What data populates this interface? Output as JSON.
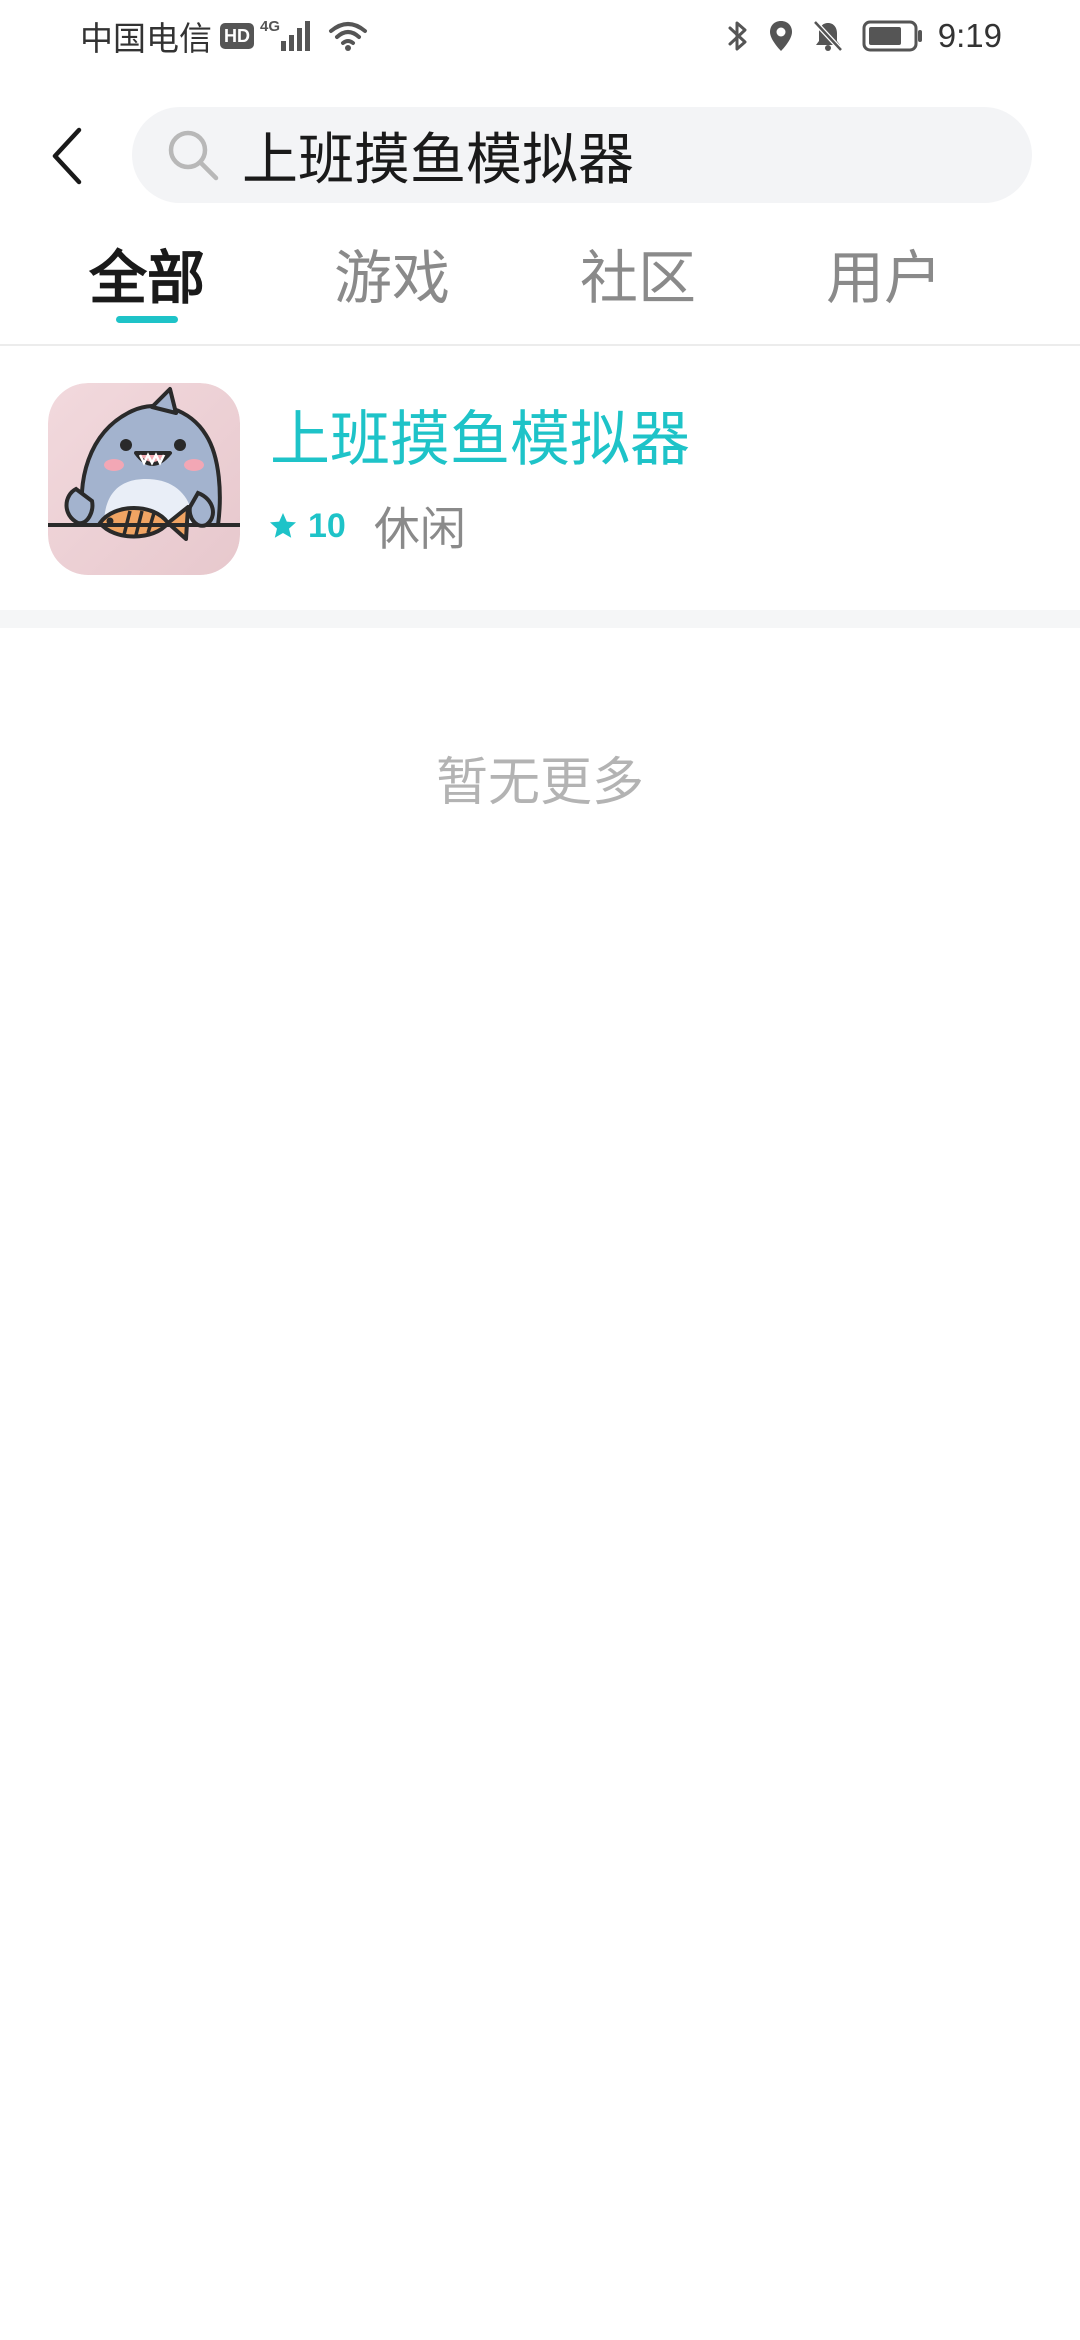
{
  "status_bar": {
    "carrier": "中国电信",
    "hd_badge": "HD",
    "network_type": "4G",
    "time": "9:19",
    "icons": [
      "signal-icon",
      "wifi-icon",
      "bluetooth-icon",
      "location-icon",
      "notifications-off-icon",
      "battery-icon"
    ]
  },
  "search": {
    "query": "上班摸鱼模拟器",
    "icons": [
      "back-arrow-icon",
      "search-icon"
    ]
  },
  "tabs": [
    {
      "label": "全部",
      "active": true
    },
    {
      "label": "游戏",
      "active": false
    },
    {
      "label": "社区",
      "active": false
    },
    {
      "label": "用户",
      "active": false
    }
  ],
  "results": [
    {
      "title": "上班摸鱼模拟器",
      "rating": "10",
      "category": "休闲",
      "icon": "shark-holding-fish-app-icon"
    }
  ],
  "footer": {
    "no_more_text": "暂无更多"
  },
  "colors": {
    "accent": "#1ec3c8",
    "search_bg": "#f3f4f6",
    "inactive_text": "#8a8a8a",
    "muted_text": "#b3b3b3"
  }
}
